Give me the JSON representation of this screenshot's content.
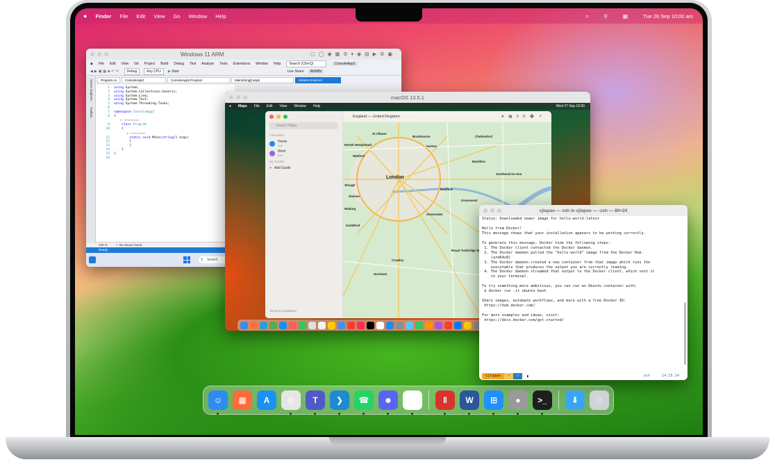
{
  "menubar": {
    "apple": "",
    "items": [
      "Finder",
      "File",
      "Edit",
      "View",
      "Go",
      "Window",
      "Help"
    ],
    "clock": "Tue 26 Sep  10:00 am"
  },
  "windows_vm": {
    "title": "Windows 11 ARM",
    "menu": [
      "File",
      "Edit",
      "View",
      "Git",
      "Project",
      "Build",
      "Debug",
      "Test",
      "Analyze",
      "Tools",
      "Extensions",
      "Window",
      "Help"
    ],
    "search_placeholder": "Search (Ctrl+Q)",
    "solution": "ConsoleApp2",
    "config": "Debug",
    "platform": "Any CPU",
    "start": "Start",
    "live_share": "Live Share",
    "admin": "ADMIN",
    "side_tabs": [
      "Server Explorer",
      "Toolbox"
    ],
    "tabs": [
      "Program.cs",
      "ConsoleApp2",
      "ConsoleApp2.Program",
      "Main(string[] args)",
      "Solution Explorer"
    ],
    "code": [
      {
        "n": "1",
        "t": "using System;"
      },
      {
        "n": "2",
        "t": "using System.Collections.Generic;"
      },
      {
        "n": "3",
        "t": "using System.Linq;"
      },
      {
        "n": "4",
        "t": "using System.Text;"
      },
      {
        "n": "5",
        "t": "using System.Threading.Tasks;"
      },
      {
        "n": "6",
        "t": ""
      },
      {
        "n": "7",
        "t": "namespace ConsoleApp2"
      },
      {
        "n": "8",
        "t": "{"
      },
      {
        "n": "",
        "t": "    0 references"
      },
      {
        "n": "9",
        "t": "    class Program"
      },
      {
        "n": "10",
        "t": "    {"
      },
      {
        "n": "",
        "t": "        0 references"
      },
      {
        "n": "11",
        "t": "        static void Main(string[] args)"
      },
      {
        "n": "12",
        "t": "        {"
      },
      {
        "n": "13",
        "t": "        }"
      },
      {
        "n": "14",
        "t": "    }"
      },
      {
        "n": "15",
        "t": "}"
      },
      {
        "n": "16",
        "t": ""
      }
    ],
    "zoom": "100 %",
    "issues": "No issues found",
    "ready": "Ready",
    "taskbar_search": "Search"
  },
  "mac_vm": {
    "title": "macOS 13.5.1",
    "menu": [
      "Maps",
      "File",
      "Edit",
      "View",
      "Window",
      "Help"
    ],
    "clock": "Wed 27 Sep  10:00",
    "maps": {
      "search_placeholder": "Search Maps",
      "favourites_label": "Favourites",
      "favourites": [
        {
          "name": "Home",
          "sub": "Add"
        },
        {
          "name": "Work",
          "sub": "Add"
        }
      ],
      "guides_label": "My Guides",
      "add_guide": "Add Guide",
      "footer": "Terms & Conditions",
      "region": "England — United Kingdom",
      "places": [
        "St Albans",
        "Broxbourne",
        "Chelmsford",
        "Harlow",
        "Hemel Hempstead",
        "Watford",
        "Basildon",
        "Southend-on-Sea",
        "London",
        "Dartford",
        "Slough",
        "Woking",
        "Guildford",
        "Crawley",
        "Maidstone",
        "Royal Tunbridge Wells",
        "Horsham",
        "Sevenoaks",
        "Gravesend",
        "Staines"
      ]
    }
  },
  "terminal": {
    "title": "cjlapao — zsh in cjlapao — -zsh — 80×24",
    "lines": [
      "Status: Downloaded newer image for hello-world:latest",
      "",
      "Hello from Docker!",
      "This message shows that your installation appears to be working correctly.",
      "",
      "To generate this message, Docker took the following steps:",
      " 1. The Docker client contacted the Docker daemon.",
      " 2. The Docker daemon pulled the \"hello-world\" image from the Docker Hub.",
      "    (arm64v8)",
      " 3. The Docker daemon created a new container from that image which runs the",
      "    executable that produces the output you are currently reading.",
      " 4. The Docker daemon streamed that output to the Docker client, which sent it",
      "    to your terminal.",
      "",
      "To try something more ambitious, you can run an Ubuntu container with:",
      " $ docker run -it ubuntu bash",
      "",
      "Share images, automate workflows, and more with a free Docker ID:",
      " https://hub.docker.com/",
      "",
      "For more examples and ideas, visit:",
      " https://docs.docker.com/get-started/"
    ],
    "prompt_user": "cjlapao",
    "prompt_dir": "~",
    "prompt_status": "✓",
    "prompt_shell": "zsh",
    "prompt_time": "14:25:14"
  },
  "dock": {
    "apps": [
      {
        "name": "Finder",
        "color": "#2d8cf0"
      },
      {
        "name": "Launchpad",
        "color": "#ff6a3a"
      },
      {
        "name": "App Store",
        "color": "#1b90f5"
      },
      {
        "name": "Chrome",
        "color": "#e6e6e6"
      },
      {
        "name": "Teams",
        "color": "#5059c9"
      },
      {
        "name": "VS Code",
        "color": "#1f8ad2"
      },
      {
        "name": "WhatsApp",
        "color": "#25d366"
      },
      {
        "name": "Discord",
        "color": "#5865f2"
      },
      {
        "name": "Slack",
        "color": "#ffffff"
      }
    ],
    "vm_apps": [
      {
        "name": "Parallels",
        "color": "#d9342b"
      },
      {
        "name": "Word",
        "color": "#2b579a"
      },
      {
        "name": "Windows",
        "color": "#1e90ff"
      },
      {
        "name": "macOS",
        "color": "#9a9a9a"
      },
      {
        "name": "Terminal",
        "color": "#1e1e1e"
      }
    ],
    "end": [
      {
        "name": "Downloads",
        "color": "#3ba4f5"
      },
      {
        "name": "Trash",
        "color": "#cfd3d6"
      }
    ]
  }
}
